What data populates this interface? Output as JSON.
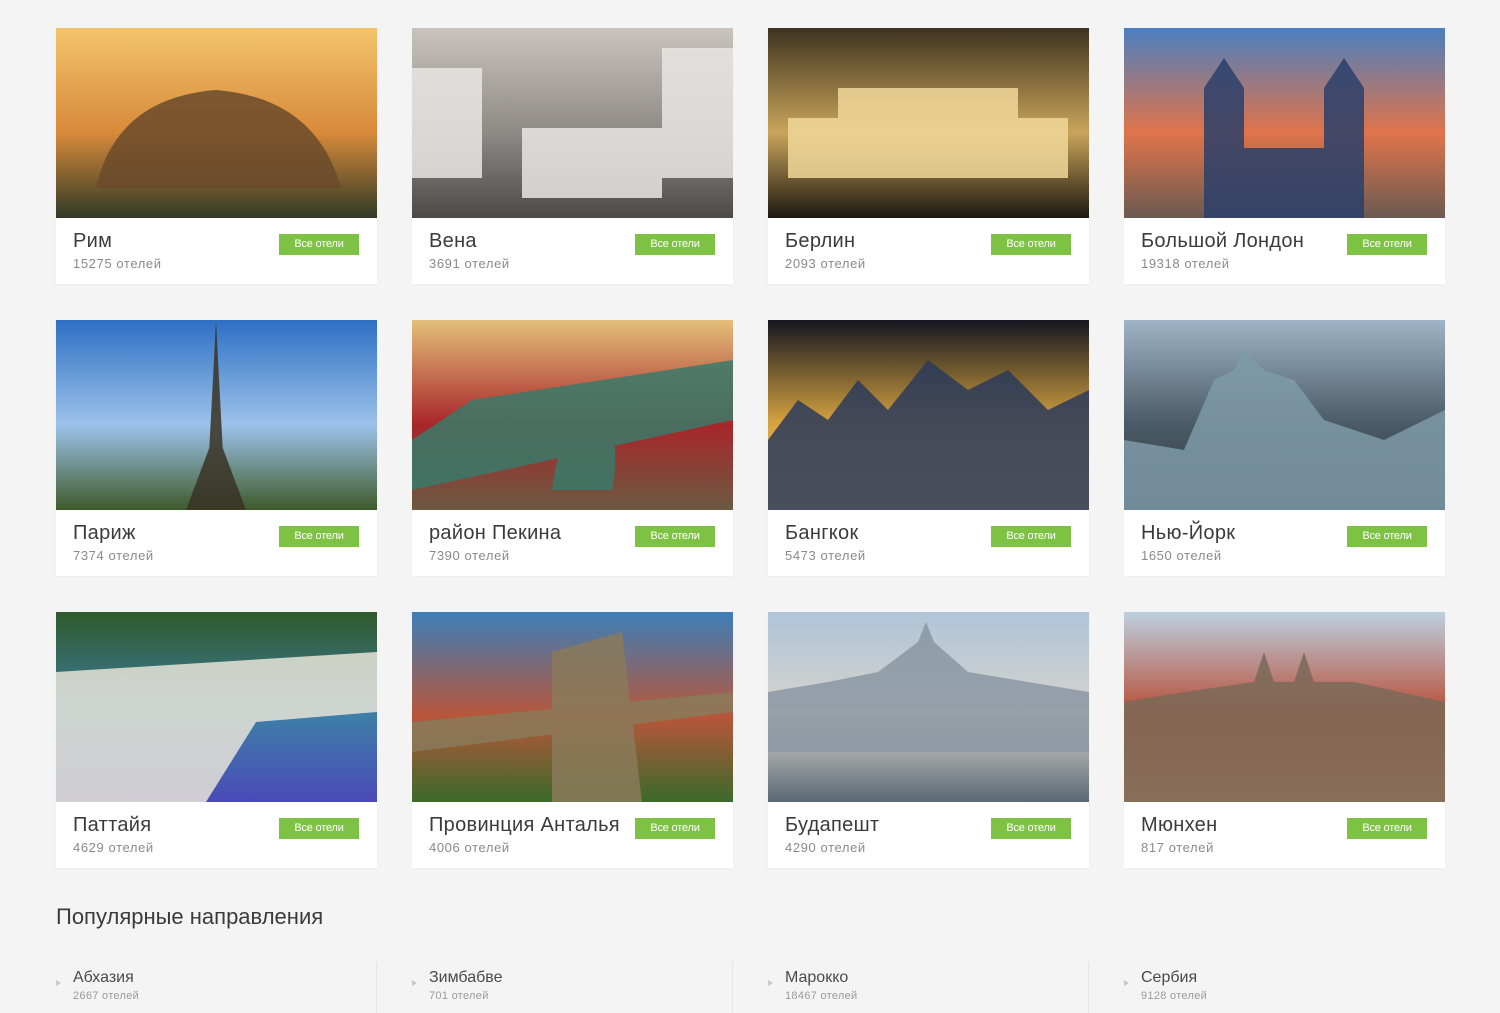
{
  "cities": [
    {
      "name": "Рим",
      "count": "15275 отелей",
      "button": "Все отели",
      "icon": "colosseum-photo",
      "colors": [
        "#f2c46a",
        "#d88a3a",
        "#6a4a2a",
        "#2f3a26"
      ]
    },
    {
      "name": "Вена",
      "count": "3691 отелей",
      "button": "Все отели",
      "icon": "horse-carriage-photo",
      "colors": [
        "#c9c4bd",
        "#8e8a86",
        "#e8e6e3",
        "#4b4a48"
      ]
    },
    {
      "name": "Берлин",
      "count": "2093 отелей",
      "button": "Все отели",
      "icon": "reichstag-photo",
      "colors": [
        "#3e3320",
        "#c9a55a",
        "#f0d79a",
        "#1d1810"
      ]
    },
    {
      "name": "Большой Лондон",
      "count": "19318 отелей",
      "button": "Все отели",
      "icon": "tower-bridge-photo",
      "colors": [
        "#4a7fc0",
        "#e0744a",
        "#2a3f6a",
        "#6b5a52"
      ]
    },
    {
      "name": "Париж",
      "count": "7374 отелей",
      "button": "Все отели",
      "icon": "eiffel-tower-photo",
      "colors": [
        "#2e6fc4",
        "#9cc3ea",
        "#3a3324",
        "#3e5a2a"
      ]
    },
    {
      "name": "район Пекина",
      "count": "7390 отелей",
      "button": "Все отели",
      "icon": "forbidden-city-photo",
      "colors": [
        "#e3c07a",
        "#a8262a",
        "#3a7a6a",
        "#6a5a42"
      ]
    },
    {
      "name": "Бангкок",
      "count": "5473 отелей",
      "button": "Все отели",
      "icon": "night-city-photo",
      "colors": [
        "#141620",
        "#d8a440",
        "#2a3a5a",
        "#f0c860"
      ]
    },
    {
      "name": "Нью-Йорк",
      "count": "1650 отелей",
      "button": "Все отели",
      "icon": "manhattan-aerial-photo",
      "colors": [
        "#9fb4c6",
        "#4a5a66",
        "#7e9aa8",
        "#2e3a42"
      ]
    },
    {
      "name": "Паттайя",
      "count": "4629 отелей",
      "button": "Все отели",
      "icon": "beach-photo",
      "colors": [
        "#2f5a2a",
        "#3e7ea8",
        "#e8e4d8",
        "#4a4ab8"
      ]
    },
    {
      "name": "Провинция Анталья",
      "count": "4006 отелей",
      "button": "Все отели",
      "icon": "red-tower-photo",
      "colors": [
        "#3d7fb8",
        "#b8563a",
        "#8a7a5a",
        "#3a6a2a"
      ]
    },
    {
      "name": "Будапешт",
      "count": "4290 отелей",
      "button": "Все отели",
      "icon": "parliament-photo",
      "colors": [
        "#aec4d8",
        "#d8d4cc",
        "#8a96a2",
        "#5a6874"
      ]
    },
    {
      "name": "Мюнхен",
      "count": "817 отелей",
      "button": "Все отели",
      "icon": "munich-rooftops-photo",
      "colors": [
        "#bcd0e0",
        "#b84a32",
        "#7a6a58",
        "#d88a5a"
      ]
    }
  ],
  "popular": {
    "title": "Популярные направления",
    "items": [
      {
        "name": "Абхазия",
        "count": "2667 отелей"
      },
      {
        "name": "Зимбабве",
        "count": "701 отелей"
      },
      {
        "name": "Марокко",
        "count": "18467 отелей"
      },
      {
        "name": "Сербия",
        "count": "9128 отелей"
      }
    ]
  },
  "colors": {
    "accent": "#7dc243",
    "background": "#f4f4f4",
    "card": "#ffffff"
  }
}
